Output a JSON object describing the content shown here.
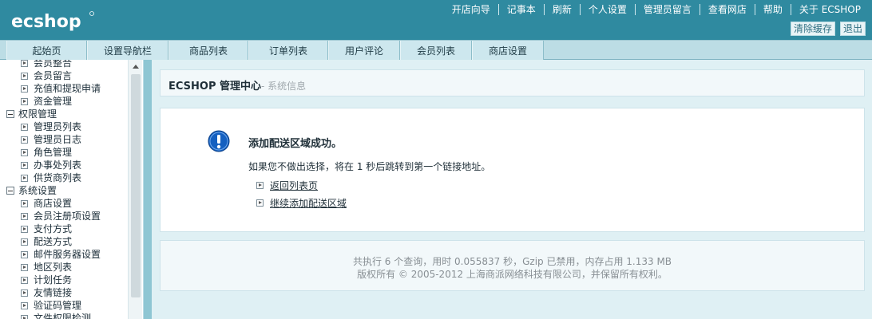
{
  "header": {
    "logo_text": "ecshop",
    "nav": [
      "开店向导",
      "记事本",
      "刷新",
      "个人设置",
      "管理员留言",
      "查看网店",
      "帮助",
      "关于 ECSHOP"
    ],
    "actions": [
      "清除缓存",
      "退出"
    ]
  },
  "tabs": [
    "起始页",
    "设置导航栏",
    "商品列表",
    "订单列表",
    "用户评论",
    "会员列表",
    "商店设置"
  ],
  "sidebar": {
    "items_top": [
      "会员整合",
      "会员留言",
      "充值和提现申请",
      "资金管理"
    ],
    "cat_perm": "权限管理",
    "items_perm": [
      "管理员列表",
      "管理员日志",
      "角色管理",
      "办事处列表",
      "供货商列表"
    ],
    "cat_sys": "系统设置",
    "items_sys": [
      "商店设置",
      "会员注册项设置",
      "支付方式",
      "配送方式",
      "邮件服务器设置",
      "地区列表",
      "计划任务",
      "友情链接",
      "验证码管理",
      "文件权限检测"
    ]
  },
  "content": {
    "title_main": "ECSHOP 管理中心",
    "title_sub": "- 系统信息",
    "message": "添加配送区域成功。",
    "description": "如果您不做出选择，将在 1 秒后跳转到第一个链接地址。",
    "links": [
      "返回列表页",
      "继续添加配送区域"
    ],
    "footer_line1": "共执行 6 个查询，用时 0.055837 秒，Gzip 已禁用，内存占用 1.133 MB",
    "footer_line2": "版权所有 © 2005-2012 上海商派网络科技有限公司，并保留所有权利。"
  },
  "colors": {
    "header": "#2f8aa0",
    "tabbar": "#bcdde5",
    "content_bg": "#dff0f4",
    "info_icon": "#1560c0"
  }
}
